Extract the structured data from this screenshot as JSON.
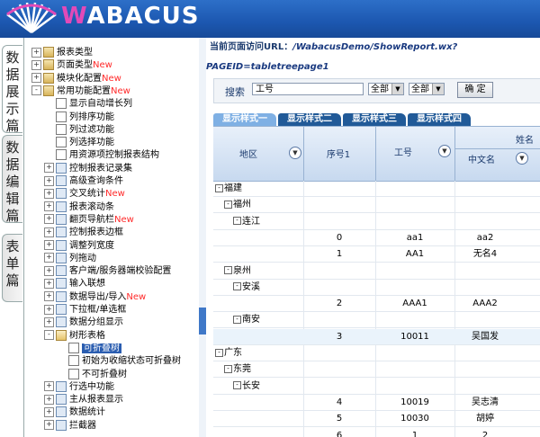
{
  "logo": {
    "first_letter": "W",
    "rest": "ABACUS"
  },
  "side_tabs": [
    {
      "label": "数据展示篇",
      "active": true
    },
    {
      "label": "数据编辑篇",
      "active": false
    },
    {
      "label": "表单篇",
      "active": false
    }
  ],
  "tree": {
    "items": [
      {
        "label": "报表类型",
        "new": "",
        "level": 0,
        "icon": "cls",
        "toggle": "+"
      },
      {
        "label": "页面类型",
        "new": "New",
        "level": 0,
        "icon": "cls",
        "toggle": "+"
      },
      {
        "label": "模块化配置",
        "new": "New",
        "level": 0,
        "icon": "cls",
        "toggle": "+"
      },
      {
        "label": "常用功能配置",
        "new": "New",
        "level": 0,
        "icon": "cls",
        "toggle": "-"
      },
      {
        "label": "显示自动增长列",
        "new": "",
        "level": 1,
        "icon": "doc",
        "toggle": ""
      },
      {
        "label": "列排序功能",
        "new": "",
        "level": 1,
        "icon": "doc",
        "toggle": ""
      },
      {
        "label": "列过滤功能",
        "new": "",
        "level": 1,
        "icon": "doc",
        "toggle": ""
      },
      {
        "label": "列选择功能",
        "new": "",
        "level": 1,
        "icon": "doc",
        "toggle": ""
      },
      {
        "label": "用资源项控制报表结构",
        "new": "",
        "level": 1,
        "icon": "doc",
        "toggle": ""
      },
      {
        "label": "控制报表记录集",
        "new": "",
        "level": 1,
        "icon": "tab",
        "toggle": "+"
      },
      {
        "label": "高级查询条件",
        "new": "",
        "level": 1,
        "icon": "tab",
        "toggle": "+"
      },
      {
        "label": "交叉统计",
        "new": "New",
        "level": 1,
        "icon": "tab",
        "toggle": "+"
      },
      {
        "label": "报表滚动条",
        "new": "",
        "level": 1,
        "icon": "tab",
        "toggle": "+"
      },
      {
        "label": "翻页导航栏",
        "new": "New",
        "level": 1,
        "icon": "tab",
        "toggle": "+"
      },
      {
        "label": "控制报表边框",
        "new": "",
        "level": 1,
        "icon": "tab",
        "toggle": "+"
      },
      {
        "label": "调整列宽度",
        "new": "",
        "level": 1,
        "icon": "tab",
        "toggle": "+"
      },
      {
        "label": "列拖动",
        "new": "",
        "level": 1,
        "icon": "tab",
        "toggle": "+"
      },
      {
        "label": "客户端/服务器端校验配置",
        "new": "",
        "level": 1,
        "icon": "tab",
        "toggle": "+"
      },
      {
        "label": "输入联想",
        "new": "",
        "level": 1,
        "icon": "tab",
        "toggle": "+"
      },
      {
        "label": "数据导出/导入",
        "new": "New",
        "level": 1,
        "icon": "tab",
        "toggle": "+"
      },
      {
        "label": "下拉框/单选框",
        "new": "",
        "level": 1,
        "icon": "tab",
        "toggle": "+"
      },
      {
        "label": "数据分组显示",
        "new": "",
        "level": 1,
        "icon": "tab",
        "toggle": "+"
      },
      {
        "label": "树形表格",
        "new": "",
        "level": 1,
        "icon": "open",
        "toggle": "-"
      },
      {
        "label": "可折叠树",
        "new": "",
        "level": 2,
        "icon": "doc",
        "toggle": "",
        "selected": true
      },
      {
        "label": "初始为收缩状态可折叠树",
        "new": "",
        "level": 2,
        "icon": "doc",
        "toggle": ""
      },
      {
        "label": "不可折叠树",
        "new": "",
        "level": 2,
        "icon": "doc",
        "toggle": ""
      },
      {
        "label": "行选中功能",
        "new": "",
        "level": 1,
        "icon": "tab",
        "toggle": "+"
      },
      {
        "label": "主从报表显示",
        "new": "",
        "level": 1,
        "icon": "tab",
        "toggle": "+"
      },
      {
        "label": "数据统计",
        "new": "",
        "level": 1,
        "icon": "tab",
        "toggle": "+"
      },
      {
        "label": "拦截器",
        "new": "",
        "level": 1,
        "icon": "tab",
        "toggle": "+"
      }
    ]
  },
  "url_bar": {
    "label": "当前页面访问URL：",
    "value": "/WabacusDemo/ShowReport.wx?PAGEID=tabletreepage1"
  },
  "search": {
    "label": "搜索",
    "field_value": "工号",
    "select1": "全部",
    "select2": "全部",
    "confirm": "确 定"
  },
  "report_tabs": [
    "显示样式一",
    "显示样式二",
    "显示样式三",
    "显示样式四"
  ],
  "grid": {
    "headers": {
      "region": "地区",
      "seq": "序号1",
      "empno": "工号",
      "name": "姓名",
      "cname": "中文名"
    },
    "rows": [
      {
        "type": "tree",
        "level": 0,
        "label": "福建"
      },
      {
        "type": "tree",
        "level": 1,
        "label": "福州"
      },
      {
        "type": "tree",
        "level": 2,
        "label": "连江"
      },
      {
        "type": "data",
        "seq": "0",
        "empno": "aa1",
        "cname": "aa2"
      },
      {
        "type": "data",
        "seq": "1",
        "empno": "AA1",
        "cname": "无名4"
      },
      {
        "type": "tree",
        "level": 1,
        "label": "泉州"
      },
      {
        "type": "tree",
        "level": 2,
        "label": "安溪"
      },
      {
        "type": "data",
        "seq": "2",
        "empno": "AAA1",
        "cname": "AAA2"
      },
      {
        "type": "tree",
        "level": 2,
        "label": "南安"
      },
      {
        "type": "data",
        "seq": "3",
        "empno": "10011",
        "cname": "吴国发",
        "highlight": true
      },
      {
        "type": "tree",
        "level": 0,
        "label": "广东"
      },
      {
        "type": "tree",
        "level": 1,
        "label": "东莞"
      },
      {
        "type": "tree",
        "level": 2,
        "label": "长安"
      },
      {
        "type": "data",
        "seq": "4",
        "empno": "10019",
        "cname": "吴志清"
      },
      {
        "type": "data",
        "seq": "5",
        "empno": "10030",
        "cname": "胡婷"
      },
      {
        "type": "data",
        "seq": "6",
        "empno": "1",
        "cname": "2"
      }
    ]
  },
  "colors": {
    "accent": "#2a5db0",
    "new": "#ff2a2a",
    "header_blue": "#1c57b0"
  }
}
